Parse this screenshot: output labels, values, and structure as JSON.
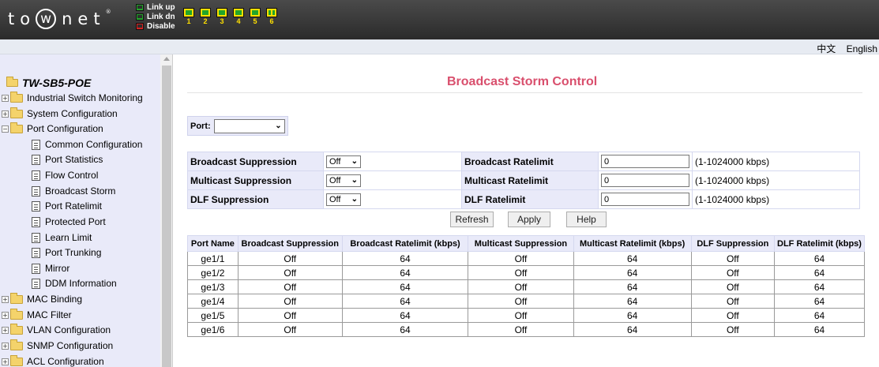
{
  "header": {
    "logo": {
      "pre": "to",
      "w": "w",
      "post": "net",
      "reg": "®"
    },
    "legend": [
      {
        "label": "Link up",
        "color": "#22a52a"
      },
      {
        "label": "Link dn",
        "color": "#2e2e2e"
      },
      {
        "label": "Disable",
        "color": "#d52020"
      }
    ],
    "ports": [
      {
        "num": "1",
        "icon": "port-link-up-icon"
      },
      {
        "num": "2",
        "icon": "port-link-up-icon"
      },
      {
        "num": "3",
        "icon": "port-link-up-icon"
      },
      {
        "num": "4",
        "icon": "port-link-up-icon"
      },
      {
        "num": "5",
        "icon": "port-link-up-icon"
      },
      {
        "num": "6",
        "icon": "port-sfp-icon"
      }
    ],
    "lang_cn": "中文",
    "lang_en": "English"
  },
  "sidebar": {
    "root": "TW-SB5-POE",
    "items": [
      {
        "label": "Industrial Switch Monitoring",
        "type": "folder",
        "expanded": false
      },
      {
        "label": "System Configuration",
        "type": "folder",
        "expanded": false
      },
      {
        "label": "Port Configuration",
        "type": "folder",
        "expanded": true
      },
      {
        "label": "Common Configuration",
        "type": "page"
      },
      {
        "label": "Port Statistics",
        "type": "page"
      },
      {
        "label": "Flow Control",
        "type": "page"
      },
      {
        "label": "Broadcast Storm",
        "type": "page"
      },
      {
        "label": "Port Ratelimit",
        "type": "page"
      },
      {
        "label": "Protected Port",
        "type": "page"
      },
      {
        "label": "Learn Limit",
        "type": "page"
      },
      {
        "label": "Port Trunking",
        "type": "page"
      },
      {
        "label": "Mirror",
        "type": "page"
      },
      {
        "label": "DDM Information",
        "type": "page"
      },
      {
        "label": "MAC Binding",
        "type": "folder",
        "expanded": false
      },
      {
        "label": "MAC Filter",
        "type": "folder",
        "expanded": false
      },
      {
        "label": "VLAN Configuration",
        "type": "folder",
        "expanded": false
      },
      {
        "label": "SNMP Configuration",
        "type": "folder",
        "expanded": false
      },
      {
        "label": "ACL Configuration",
        "type": "folder",
        "expanded": false
      }
    ]
  },
  "main": {
    "title": "Broadcast Storm Control",
    "port_label": "Port:",
    "port_value": "",
    "config": [
      {
        "label": "Broadcast Suppression",
        "value": "Off",
        "rate_label": "Broadcast Ratelimit",
        "rate_value": "0",
        "range": "(1-1024000 kbps)"
      },
      {
        "label": "Multicast Suppression",
        "value": "Off",
        "rate_label": "Multicast Ratelimit",
        "rate_value": "0",
        "range": "(1-1024000 kbps)"
      },
      {
        "label": "DLF Suppression",
        "value": "Off",
        "rate_label": "DLF Ratelimit",
        "rate_value": "0",
        "range": "(1-1024000 kbps)"
      }
    ],
    "buttons": {
      "refresh": "Refresh",
      "apply": "Apply",
      "help": "Help"
    },
    "table": {
      "headers": [
        "Port Name",
        "Broadcast Suppression",
        "Broadcast Ratelimit (kbps)",
        "Multicast Suppression",
        "Multicast Ratelimit (kbps)",
        "DLF Suppression",
        "DLF Ratelimit (kbps)"
      ],
      "rows": [
        [
          "ge1/1",
          "Off",
          "64",
          "Off",
          "64",
          "Off",
          "64"
        ],
        [
          "ge1/2",
          "Off",
          "64",
          "Off",
          "64",
          "Off",
          "64"
        ],
        [
          "ge1/3",
          "Off",
          "64",
          "Off",
          "64",
          "Off",
          "64"
        ],
        [
          "ge1/4",
          "Off",
          "64",
          "Off",
          "64",
          "Off",
          "64"
        ],
        [
          "ge1/5",
          "Off",
          "64",
          "Off",
          "64",
          "Off",
          "64"
        ],
        [
          "ge1/6",
          "Off",
          "64",
          "Off",
          "64",
          "Off",
          "64"
        ]
      ]
    }
  }
}
